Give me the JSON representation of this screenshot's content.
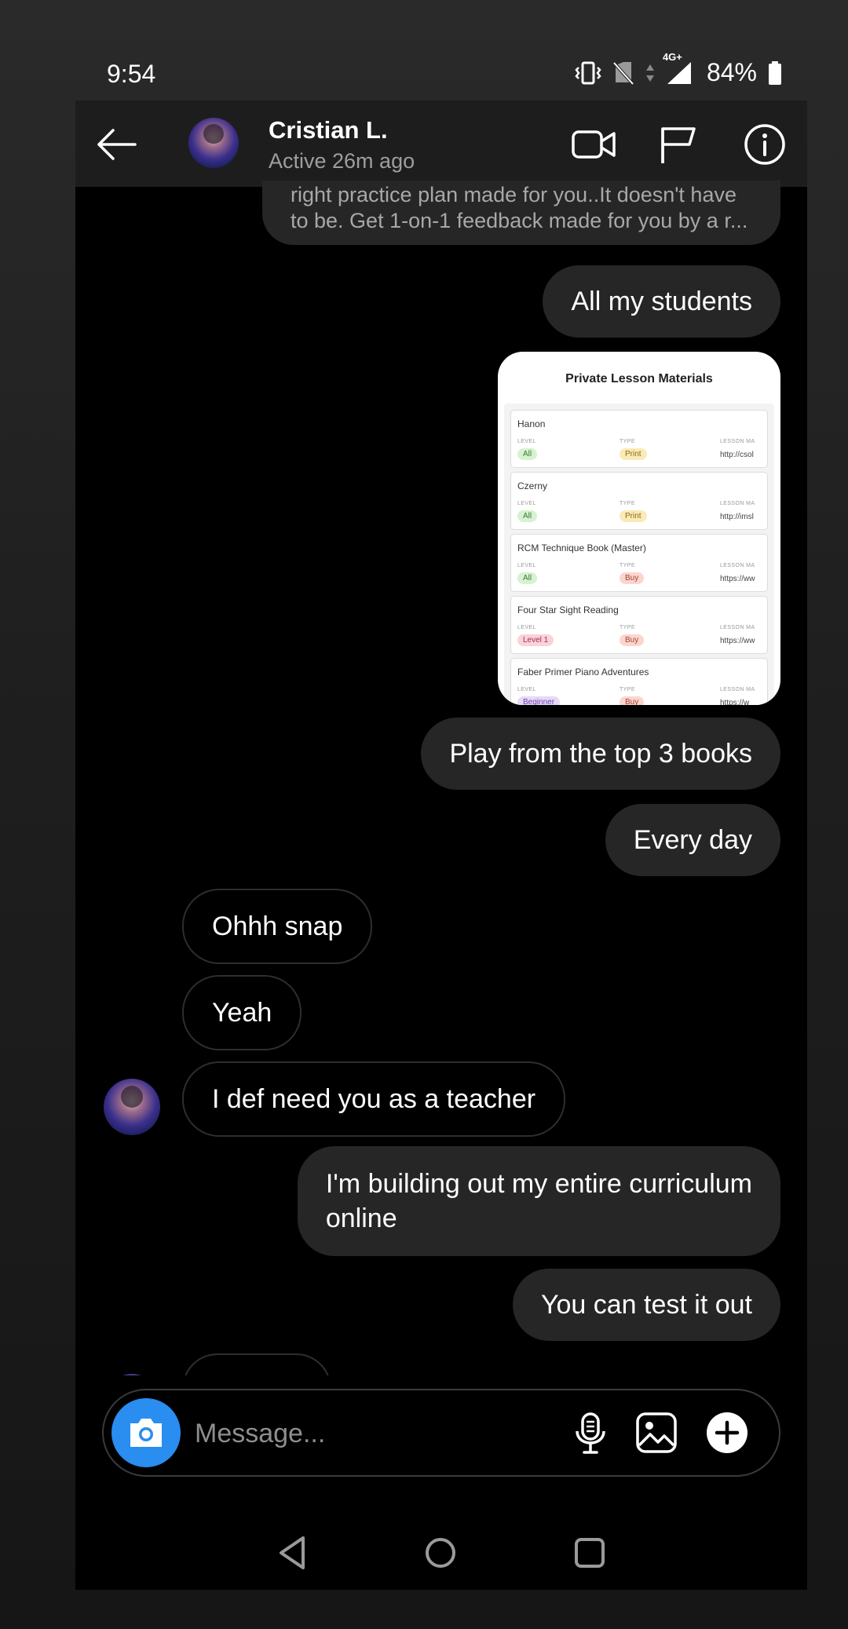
{
  "status_bar": {
    "time": "9:54",
    "network": "4G+",
    "battery": "84%",
    "icons": [
      "vibrate-icon",
      "no-sim-icon",
      "data-arrows-icon",
      "signal-icon",
      "battery-icon"
    ]
  },
  "header": {
    "contact_name": "Cristian L.",
    "contact_status": "Active 26m ago",
    "icons": [
      "back-arrow-icon",
      "avatar",
      "video-call-icon",
      "flag-icon",
      "info-icon"
    ]
  },
  "messages": {
    "truncated_preview_line1": "right practice plan made for you..It doesn't have",
    "truncated_preview_line2": "to be. Get 1-on-1 feedback made for you by a r...",
    "m1": "All my students",
    "m2": "Play from the top 3 books",
    "m3": "Every day",
    "m4": "Ohhh snap",
    "m5": "Yeah",
    "m6": "I def need you as a teacher",
    "m7_line1": "I'm building out my entire curriculum",
    "m7_line2": "online",
    "m8": "You can test it out"
  },
  "shared_card": {
    "title": "Private Lesson Materials",
    "col_level": "LEVEL",
    "col_type": "TYPE",
    "col_material": "LESSON MA",
    "rows": [
      {
        "name": "Hanon",
        "level": "All",
        "type": "Print",
        "url": "http://csol"
      },
      {
        "name": "Czerny",
        "level": "All",
        "type": "Print",
        "url": "http://imsl"
      },
      {
        "name": "RCM Technique Book (Master)",
        "level": "All",
        "type": "Buy",
        "url": "https://ww"
      },
      {
        "name": "Four Star Sight Reading",
        "level": "Level 1",
        "type": "Buy",
        "url": "https://ww"
      },
      {
        "name": "Faber Primer Piano Adventures",
        "level": "Beginner",
        "type": "Buy",
        "url": "https://w"
      }
    ],
    "tag_colors": {
      "All": "#d6f2d0",
      "Print": "#fbeab8",
      "Buy": "#fad6cf",
      "Level 1": "#f9d2da",
      "Beginner": "#e6d9f7"
    }
  },
  "composer": {
    "placeholder": "Message...",
    "icons": [
      "camera-icon",
      "microphone-icon",
      "gallery-icon",
      "plus-icon"
    ]
  },
  "nav": {
    "icons": [
      "nav-back-icon",
      "nav-home-icon",
      "nav-recents-icon"
    ]
  },
  "colors": {
    "outgoing_bubble": "#262626",
    "incoming_border": "#2e2e2e",
    "camera_button": "#2a8df0",
    "background": "#000000"
  }
}
